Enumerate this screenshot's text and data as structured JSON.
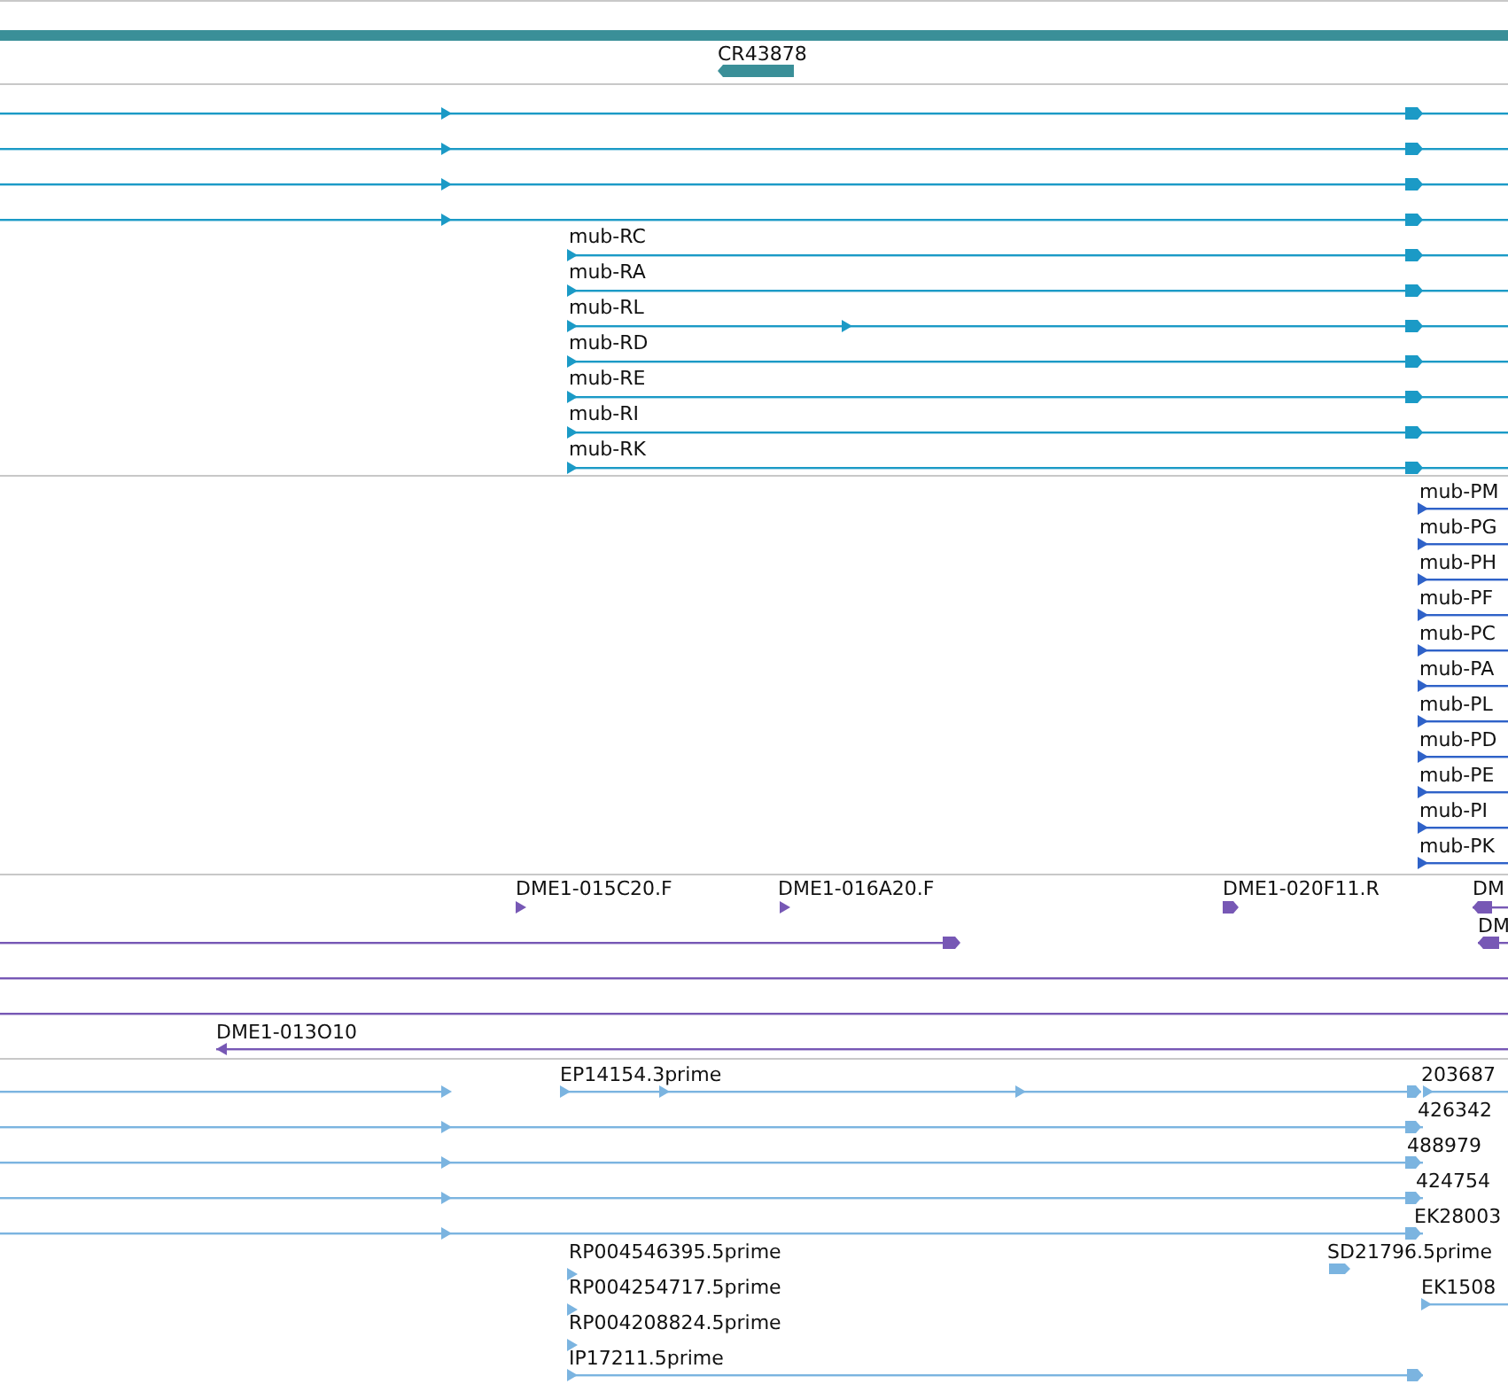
{
  "tracks": [
    {
      "kind": "gene",
      "features": [
        {
          "label": "CR43878",
          "reverse": true
        }
      ]
    },
    {
      "kind": "transcript",
      "features": [
        {
          "reverse": false
        },
        {
          "reverse": false
        },
        {
          "reverse": false
        },
        {
          "reverse": false
        },
        {
          "label": "mub-RC",
          "reverse": false
        },
        {
          "label": "mub-RA",
          "reverse": false
        },
        {
          "label": "mub-RL",
          "reverse": false
        },
        {
          "label": "mub-RD",
          "reverse": false
        },
        {
          "label": "mub-RE",
          "reverse": false
        },
        {
          "label": "mub-RI",
          "reverse": false
        },
        {
          "label": "mub-RK",
          "reverse": false
        }
      ]
    },
    {
      "kind": "protein",
      "features": [
        {
          "label": "mub-PM",
          "reverse": false
        },
        {
          "label": "mub-PG",
          "reverse": false
        },
        {
          "label": "mub-PH",
          "reverse": false
        },
        {
          "label": "mub-PF",
          "reverse": false
        },
        {
          "label": "mub-PC",
          "reverse": false
        },
        {
          "label": "mub-PA",
          "reverse": false
        },
        {
          "label": "mub-PL",
          "reverse": false
        },
        {
          "label": "mub-PD",
          "reverse": false
        },
        {
          "label": "mub-PE",
          "reverse": false
        },
        {
          "label": "mub-PI",
          "reverse": false
        },
        {
          "label": "mub-PK",
          "reverse": false
        }
      ]
    },
    {
      "kind": "clone",
      "features": [
        {
          "label": "DME1-015C20.F",
          "reverse": false
        },
        {
          "label": "DME1-016A20.F",
          "reverse": false
        },
        {
          "label": "DME1-020F11.R",
          "reverse": false
        },
        {
          "label": "DM",
          "reverse": true
        },
        {
          "reverse": false
        },
        {
          "label": "DM",
          "reverse": true
        },
        {
          "label": "DME1-013O10",
          "reverse": true
        }
      ]
    },
    {
      "kind": "est",
      "features": [
        {
          "reverse": false
        },
        {
          "label": "EP14154.3prime",
          "reverse": false
        },
        {
          "label": "203687",
          "reverse": false
        },
        {
          "label": "426342",
          "reverse": false
        },
        {
          "label": "488979",
          "reverse": false
        },
        {
          "label": "424754",
          "reverse": false
        },
        {
          "label": "EK28003",
          "reverse": false
        },
        {
          "label": "RP004546395.5prime",
          "reverse": false
        },
        {
          "label": "SD21796.5prime",
          "reverse": false
        },
        {
          "label": "RP004254717.5prime",
          "reverse": false
        },
        {
          "label": "EK1508",
          "reverse": false
        },
        {
          "label": "RP004208824.5prime",
          "reverse": false
        },
        {
          "label": "IP17211.5prime",
          "reverse": false
        }
      ]
    }
  ]
}
